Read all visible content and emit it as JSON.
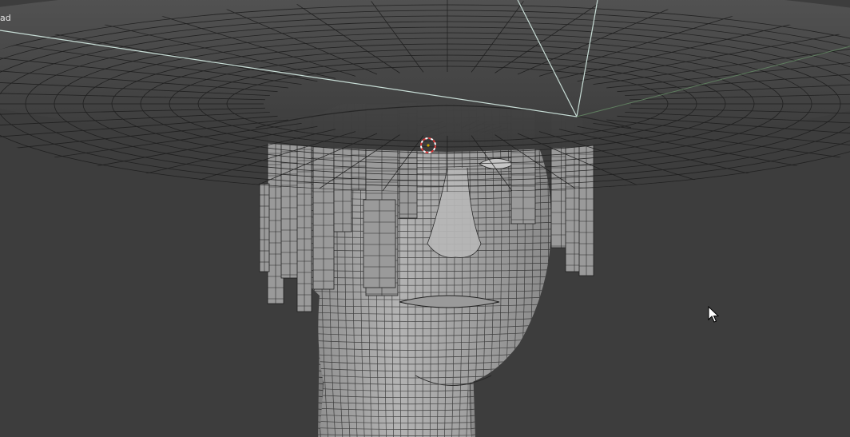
{
  "viewport": {
    "object_label": "ad",
    "background": "#3d3d3d"
  },
  "colors": {
    "hat": "#4a4a4a",
    "hat_underside": "#2c2c2c",
    "skin": "#a8a8a8",
    "hair": "#9a9a9a",
    "wire": "#1e1e1e",
    "camera_frame": "#c8ddd6",
    "axis_line": "#5f7d5f",
    "cursor_ring": "#d83a3a"
  },
  "icons": {
    "cursor_3d": "3d-cursor-icon",
    "mouse_pointer": "mouse-pointer-icon"
  }
}
